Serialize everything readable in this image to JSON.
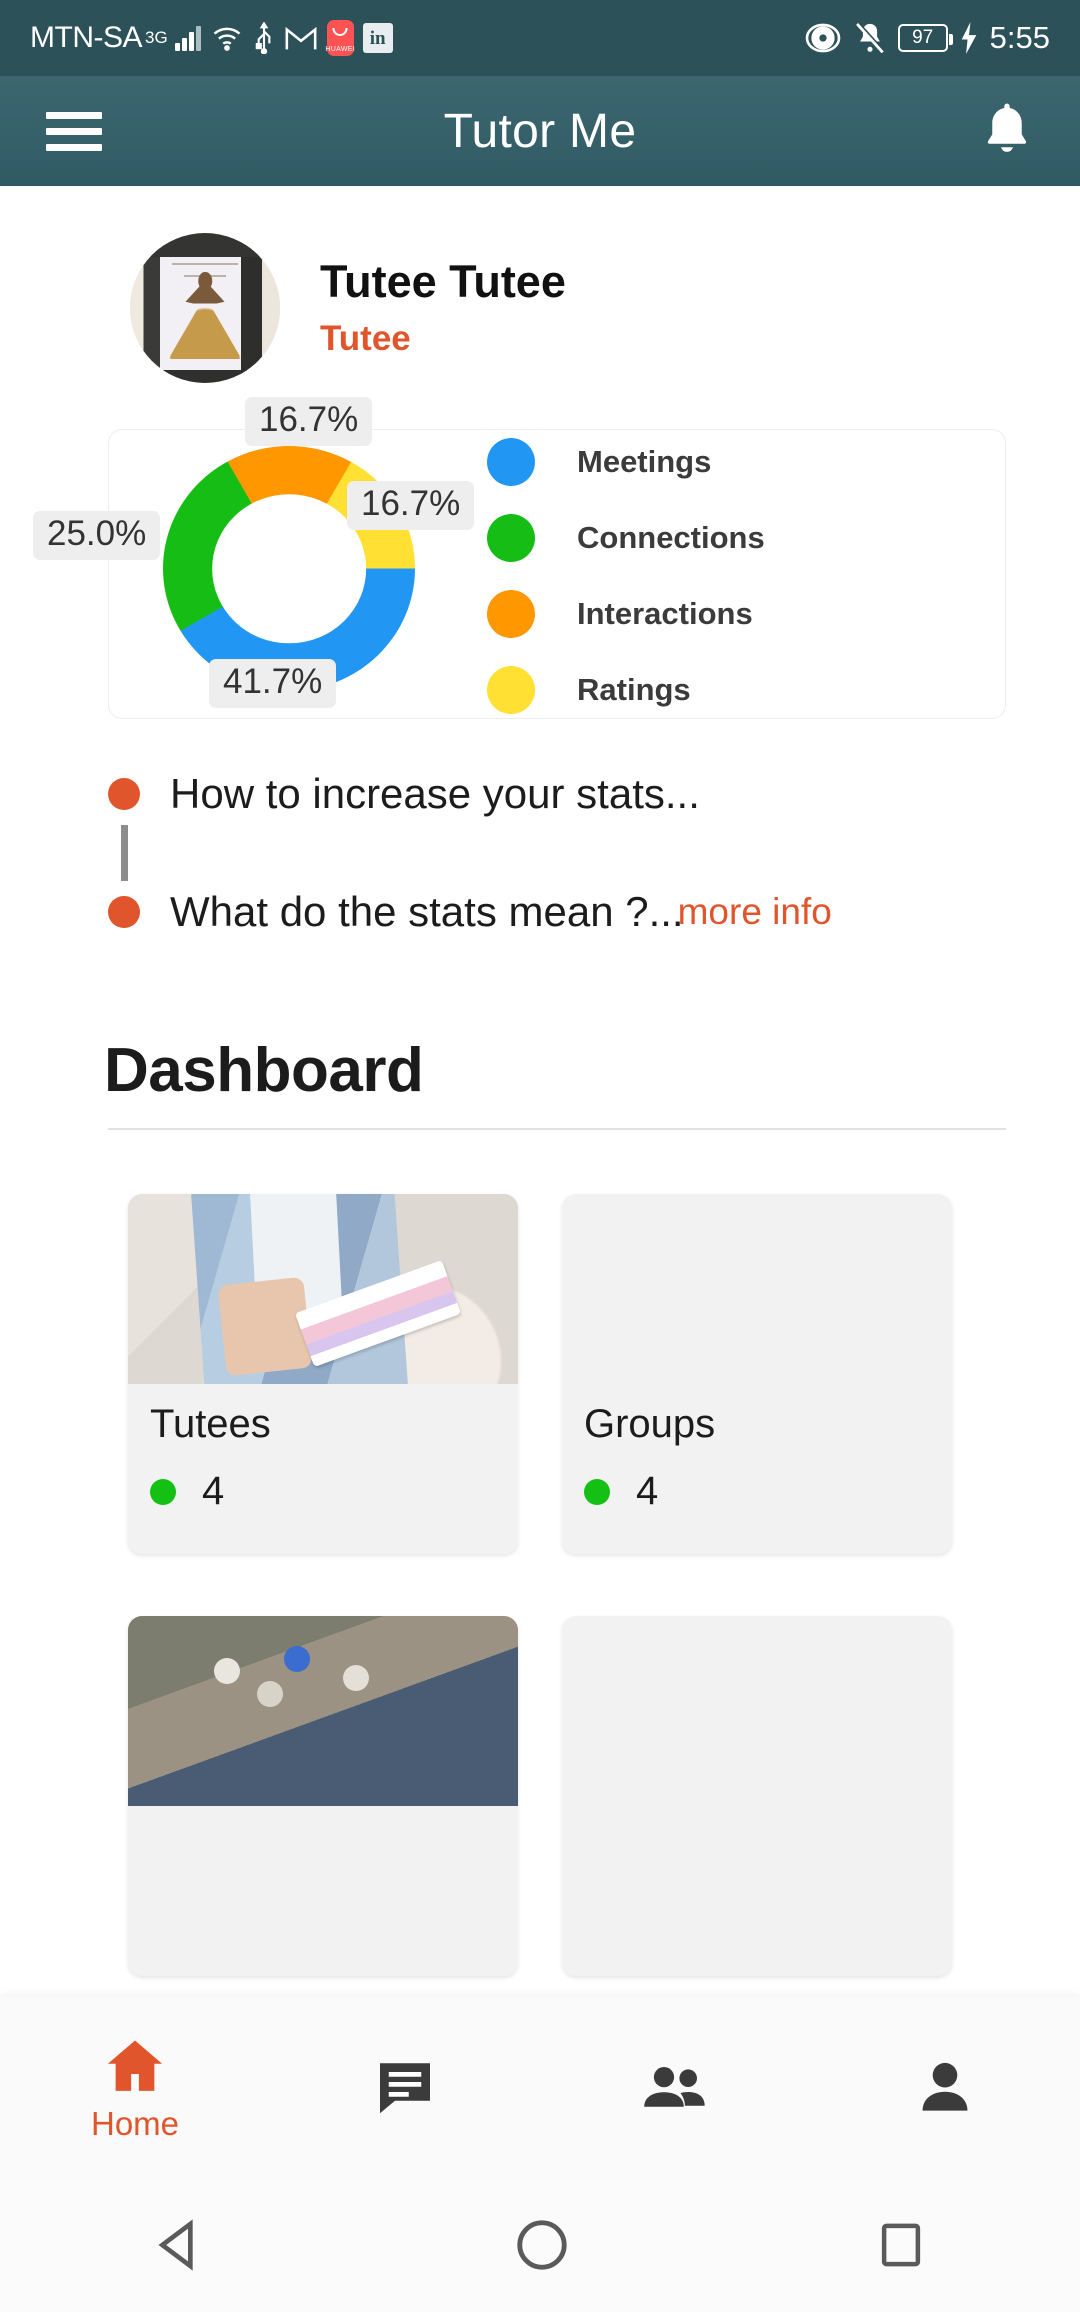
{
  "status_bar": {
    "carrier": "MTN-SA",
    "network": "3G",
    "battery_level": "97",
    "time": "5:55",
    "icons": [
      "signal-bars-icon",
      "wifi-icon",
      "usb-icon",
      "gmail-icon",
      "huawei-icon",
      "linkedin-icon",
      "eye-icon",
      "bell-muted-icon",
      "battery-icon",
      "charging-bolt-icon"
    ],
    "huawei_label": "HUAWEI",
    "linkedin_label": "in",
    "gmail_label": "M"
  },
  "app_bar": {
    "title": "Tutor Me",
    "menu_icon": "hamburger-menu-icon",
    "notification_icon": "bell-icon"
  },
  "profile": {
    "name": "Tutee Tutee",
    "role": "Tutee"
  },
  "chart_data": {
    "type": "pie",
    "title": "",
    "labels": [
      "Meetings",
      "Connections",
      "Interactions",
      "Ratings"
    ],
    "values": [
      41.7,
      25.0,
      16.7,
      16.7
    ],
    "value_labels": [
      "41.7%",
      "25.0%",
      "16.7%",
      "16.7%"
    ],
    "colors": [
      "#2196f3",
      "#15bd15",
      "#ff9800",
      "#ffe033"
    ],
    "legend": [
      {
        "label": "Meetings",
        "color": "#2196f3"
      },
      {
        "label": "Connections",
        "color": "#15bd15"
      },
      {
        "label": "Interactions",
        "color": "#ff9800"
      },
      {
        "label": "Ratings",
        "color": "#ffe033"
      }
    ],
    "legend_position": "right",
    "donut": true,
    "grid": false,
    "annotations": [
      {
        "text": "16.7%",
        "position": "top",
        "series": "Interactions"
      },
      {
        "text": "16.7%",
        "position": "right",
        "series": "Ratings"
      },
      {
        "text": "25.0%",
        "position": "left",
        "series": "Connections"
      },
      {
        "text": "41.7%",
        "position": "bottom",
        "series": "Meetings"
      }
    ]
  },
  "info_links": {
    "item1": "How to increase your stats...",
    "item2": "What do the stats mean ?...",
    "more_info": "more info"
  },
  "dashboard": {
    "title": "Dashboard",
    "cards": [
      {
        "title": "Tutees",
        "count": "4",
        "status_color": "#14c014",
        "has_image": true
      },
      {
        "title": "Groups",
        "count": "4",
        "status_color": "#14c014",
        "has_image": false
      }
    ]
  },
  "fab": {
    "icon": "add-person-icon",
    "color": "#d4623c"
  },
  "bottom_nav": {
    "items": [
      {
        "label": "Home",
        "icon": "home-icon",
        "active": true
      },
      {
        "label": "",
        "icon": "chat-icon",
        "active": false
      },
      {
        "label": "",
        "icon": "people-icon",
        "active": false
      },
      {
        "label": "",
        "icon": "person-icon",
        "active": false
      }
    ],
    "active_color": "#e0552b"
  },
  "android_nav": {
    "back": "back-triangle-icon",
    "home": "home-circle-icon",
    "recents": "recents-square-icon"
  }
}
